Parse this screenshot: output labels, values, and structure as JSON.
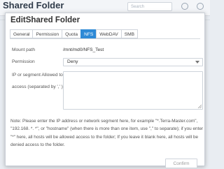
{
  "background": {
    "page_title": "Shared Folder",
    "search_placeholder": "Search"
  },
  "dialog": {
    "title": "EditShared Folder",
    "tabs": [
      {
        "label": "General",
        "active": false
      },
      {
        "label": "Permission",
        "active": false
      },
      {
        "label": "Quota",
        "active": false
      },
      {
        "label": "NFS",
        "active": true
      },
      {
        "label": "WebDAV",
        "active": false
      },
      {
        "label": "SMB",
        "active": false
      }
    ],
    "mount_path_label": "Mount path",
    "mount_path_value": "/mnt/md0/NFS_Test",
    "permission_label": "Permission",
    "permission_value": "Deny",
    "ip_label_line1": "IP or segment Allowed to",
    "ip_label_line2": "access (separated by ',' )",
    "ip_value": "",
    "note": "Note: Please enter the IP address or network segment here, for example \"*.Terra-Master.com\", \"192.168. *. *\", or \"hostname\" (when there is more than one item, use \",\" to separate); if you enter \"*\" here, all hosts will be allowed access to the folder; If you leave it blank here, all hosts will be denied access to the folder.",
    "confirm_label": "Confirm"
  },
  "colors": {
    "accent": "#2e8ad6"
  }
}
